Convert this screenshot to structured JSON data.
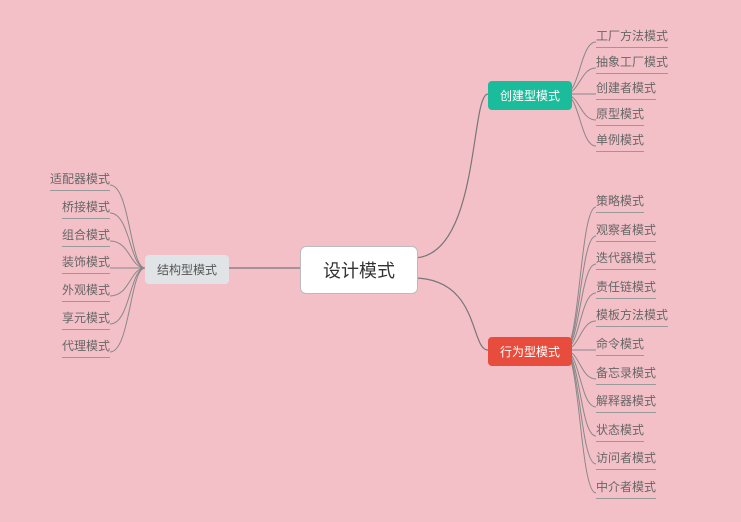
{
  "root": {
    "label": "设计模式"
  },
  "branches": {
    "structural": {
      "label": "结构型模式",
      "children": [
        "适配器模式",
        "桥接模式",
        "组合模式",
        "装饰模式",
        "外观模式",
        "享元模式",
        "代理模式"
      ]
    },
    "creational": {
      "label": "创建型模式",
      "children": [
        "工厂方法模式",
        "抽象工厂模式",
        "创建者模式",
        "原型模式",
        "单例模式"
      ]
    },
    "behavioral": {
      "label": "行为型模式",
      "children": [
        "策略模式",
        "观察者模式",
        "迭代器模式",
        "责任链模式",
        "模板方法模式",
        "命令模式",
        "备忘录模式",
        "解释器模式",
        "状态模式",
        "访问者模式",
        "中介者模式"
      ]
    }
  }
}
